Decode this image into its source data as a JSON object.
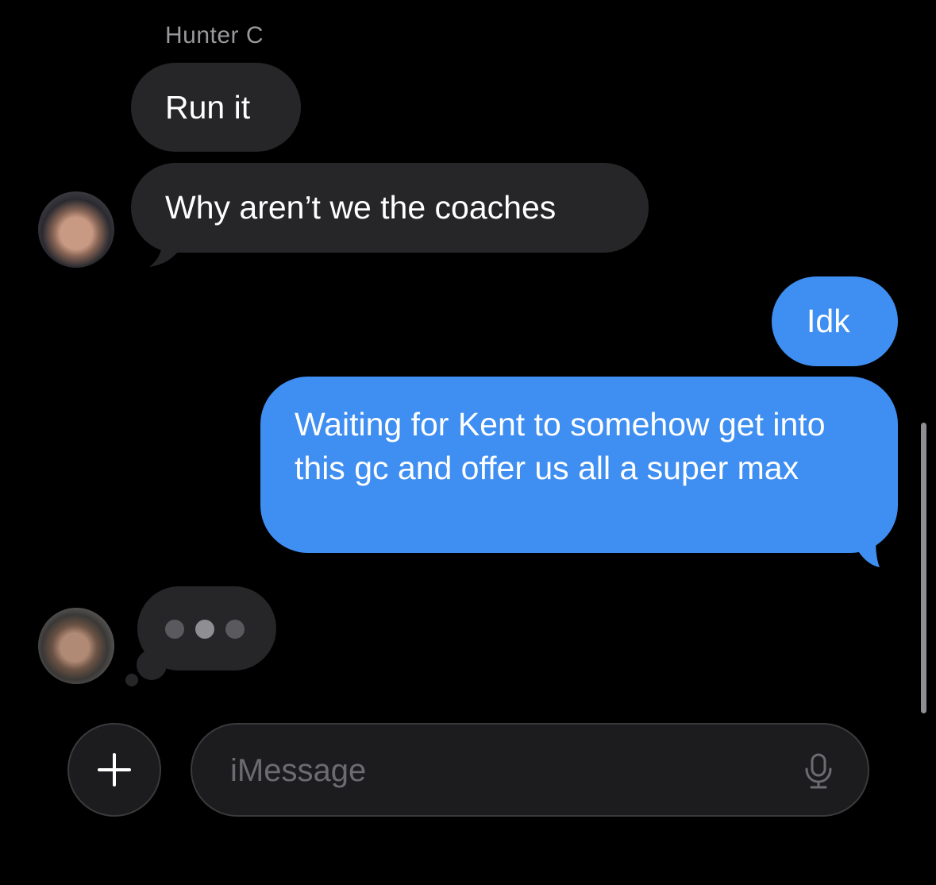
{
  "conversation": {
    "sender_name": "Hunter C",
    "messages": [
      {
        "direction": "incoming",
        "text": "Run it"
      },
      {
        "direction": "incoming",
        "text": "Why aren’t we the coaches"
      },
      {
        "direction": "outgoing",
        "text": "Idk"
      },
      {
        "direction": "outgoing",
        "text": "Waiting for Kent to somehow get into this gc and offer us all a super max"
      }
    ],
    "typing_indicator": true
  },
  "composer": {
    "placeholder": "iMessage",
    "add_icon": "plus-icon",
    "mic_icon": "microphone-icon"
  },
  "colors": {
    "background": "#000000",
    "incoming_bubble": "#262628",
    "outgoing_bubble": "#3f8ef2",
    "sender_name": "#98989d"
  }
}
